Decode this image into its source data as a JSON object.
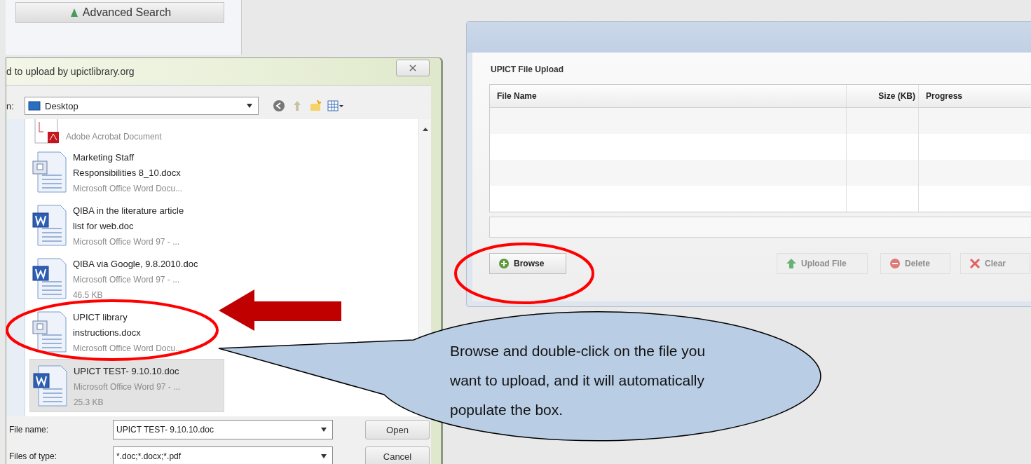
{
  "browser_fragment": {
    "button": "Advanced Search"
  },
  "file_dialog": {
    "title": "d to upload by upictlibrary.org",
    "look_in": {
      "label": "n:",
      "value": "Desktop"
    },
    "files": [
      {
        "kind": "pdf",
        "type": "Adobe Acrobat Document",
        "selected": false
      },
      {
        "kind": "docx",
        "name_lines": [
          "Marketing Staff",
          "Responsibilities 8_10.docx"
        ],
        "type": "Microsoft Office Word Docu...",
        "selected": false
      },
      {
        "kind": "doc",
        "name_lines": [
          "QIBA in the literature article",
          "list for web.doc"
        ],
        "type": "Microsoft Office Word 97 - ...",
        "selected": false
      },
      {
        "kind": "doc",
        "name_lines": [
          "QIBA via Google, 9.8.2010.doc"
        ],
        "type": "Microsoft Office Word 97 - ...",
        "size": "46.5 KB",
        "selected": false
      },
      {
        "kind": "docx",
        "name_lines": [
          "UPICT library",
          "instructions.docx"
        ],
        "type": "Microsoft Office Word Docu...",
        "selected": false
      },
      {
        "kind": "doc",
        "name_lines": [
          "UPICT TEST- 9.10.10.doc"
        ],
        "type": "Microsoft Office Word 97 - ...",
        "size": "25.3 KB",
        "selected": true
      }
    ],
    "file_name": {
      "label": "File name:",
      "value": "UPICT TEST- 9.10.10.doc"
    },
    "file_type": {
      "label": "Files of type:",
      "value": "*.doc;*.docx;*.pdf"
    },
    "buttons": [
      "Open",
      "Cancel"
    ]
  },
  "upload_window": {
    "title": "UPICT File Upload",
    "columns": [
      "File Name",
      "Size (KB)",
      "Progress"
    ],
    "buttons": [
      {
        "kind": "add",
        "label": "Browse",
        "disabled": false
      },
      {
        "kind": "upload",
        "label": "Upload File",
        "disabled": true
      },
      {
        "kind": "delete",
        "label": "Delete",
        "disabled": true
      },
      {
        "kind": "clear",
        "label": "Clear",
        "disabled": true
      }
    ]
  },
  "annotation": {
    "callout": "Browse and double-click on the file you want to upload, and it will automatically populate the box."
  }
}
